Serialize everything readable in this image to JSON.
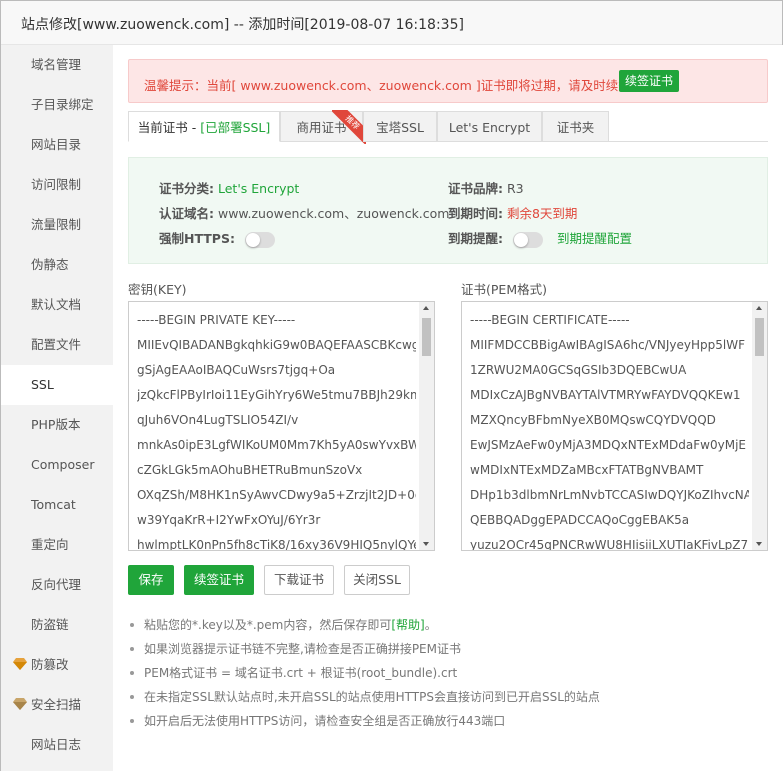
{
  "window": {
    "title": "站点修改[www.zuowenck.com] -- 添加时间[2019-08-07 16:18:35]"
  },
  "sidebar": {
    "items": [
      {
        "label": "域名管理",
        "vip": false
      },
      {
        "label": "子目录绑定",
        "vip": false
      },
      {
        "label": "网站目录",
        "vip": false
      },
      {
        "label": "访问限制",
        "vip": false
      },
      {
        "label": "流量限制",
        "vip": false
      },
      {
        "label": "伪静态",
        "vip": false
      },
      {
        "label": "默认文档",
        "vip": false
      },
      {
        "label": "配置文件",
        "vip": false
      },
      {
        "label": "SSL",
        "vip": false,
        "active": true
      },
      {
        "label": "PHP版本",
        "vip": false
      },
      {
        "label": "Composer",
        "vip": false
      },
      {
        "label": "Tomcat",
        "vip": false
      },
      {
        "label": "重定向",
        "vip": false
      },
      {
        "label": "反向代理",
        "vip": false
      },
      {
        "label": "防盗链",
        "vip": false
      },
      {
        "label": "防篡改",
        "vip": true
      },
      {
        "label": "安全扫描",
        "vip": true
      },
      {
        "label": "网站日志",
        "vip": false
      }
    ]
  },
  "warning": {
    "text": "温馨提示：当前[ www.zuowenck.com、zuowenck.com ]证书即将过期，请及时续签",
    "button": "续签证书"
  },
  "tabs": {
    "current_prefix": "当前证书 - ",
    "current_status": "[已部署SSL]",
    "commercial": "商用证书",
    "commercial_badge": "推荐",
    "baota": "宝塔SSL",
    "letsencrypt": "Let's Encrypt",
    "folder": "证书夹"
  },
  "cert_info": {
    "category_label": "证书分类:",
    "category_value": "Let's Encrypt",
    "brand_label": "证书品牌:",
    "brand_value": "R3",
    "domain_label": "认证域名:",
    "domain_value": "www.zuowenck.com、zuowenck.com",
    "expire_label": "到期时间:",
    "expire_value": "剩余8天到期",
    "https_label": "强制HTTPS:",
    "https_enabled": false,
    "remind_label": "到期提醒:",
    "remind_enabled": false,
    "remind_link": "到期提醒配置"
  },
  "key_field": {
    "label": "密钥(KEY)",
    "lines": [
      "-----BEGIN PRIVATE KEY-----",
      "MIIEvQIBADANBgkqhkiG9w0BAQEFAASCBKcwg",
      "gSjAgEAAoIBAQCuWsrs7tjgq+Oa",
      "jzQkcFlPByIrIoi11EyGihYry6We5tmu7BBJh29km",
      "qJuh6VOn4LugTSLIO54ZI/v",
      "mnkAs0ipE3LgfWIKoUM0Mm7Kh5yA0swYvxBW",
      "cZGkLGk5mAOhuBHETRuBmunSzoVx",
      "OXqZSh/M8HK1nSyAwvCDwy9a5+ZrzjIt2JD+0q",
      "w39YqaKrR+I2YwFxOYuJ/6Yr3r",
      "hwlmptLK0nPn5fh8cTiK8/16xy36V9HIQ5nylQYe"
    ]
  },
  "cert_field": {
    "label": "证书(PEM格式)",
    "lines": [
      "-----BEGIN CERTIFICATE-----",
      "MIIFMDCCBBigAwIBAgISA6hc/VNJyeyHpp5lWF",
      "1ZRWU2MA0GCSqGSIb3DQEBCwUA",
      "MDIxCzAJBgNVBAYTAlVTMRYwFAYDVQQKEw1",
      "MZXQncyBFbmNyeXB0MQswCQYDVQQD",
      "EwJSMzAeFw0yMjA3MDQxNTExMDdaFw0yMjE",
      "wMDIxNTExMDZaMBcxFTATBgNVBAMT",
      "DHp1b3dlbmNrLmNvbTCCASIwDQYJKoZIhvcNA",
      "QEBBQADggEPADCCAQoCggEBAK5a",
      "yuzu2OCr45qPNCRwWU8HIisiiLXUTIaKFivLpZ7"
    ]
  },
  "buttons": {
    "save": "保存",
    "renew": "续签证书",
    "download": "下载证书",
    "close_ssl": "关闭SSL"
  },
  "tips": {
    "tip1_prefix": "粘贴您的*.key以及*.pem内容，然后保存即可",
    "tip1_link": "[帮助]",
    "tip1_suffix": "。",
    "tip2": "如果浏览器提示证书链不完整,请检查是否正确拼接PEM证书",
    "tip3": "PEM格式证书 = 域名证书.crt + 根证书(root_bundle).crt",
    "tip4": "在未指定SSL默认站点时,未开启SSL的站点使用HTTPS会直接访问到已开启SSL的站点",
    "tip5": "如开启后无法使用HTTPS访问，请检查安全组是否正确放行443端口"
  },
  "colors": {
    "accent_green": "#20a53a",
    "warning_red": "#e0473b",
    "vip_gold": "#e6a23c"
  }
}
